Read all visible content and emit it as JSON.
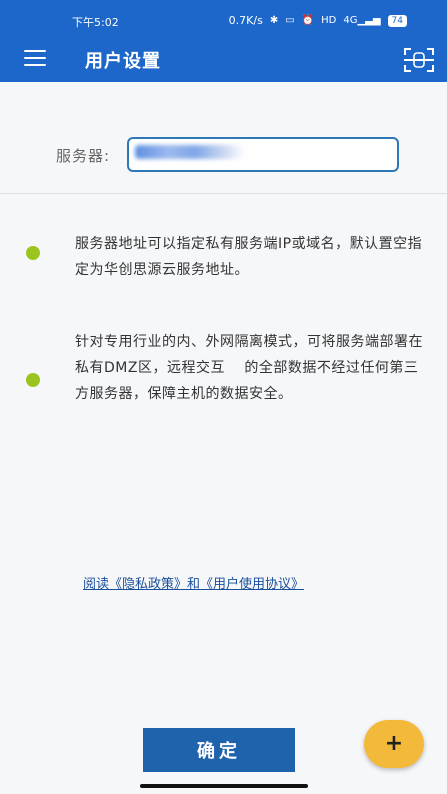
{
  "status_bar": {
    "time": "下午5:02",
    "speed": "0.7K/s",
    "hd": "HD",
    "signal": "4G",
    "battery": "74"
  },
  "toolbar": {
    "title": "用户设置"
  },
  "form": {
    "server_label": "服务器:"
  },
  "info": {
    "paragraph_1": "服务器地址可以指定私有服务端IP或域名，默认置空指定为华创思源云服务地址。",
    "paragraph_2": "针对专用行业的内、外网隔离模式，可将服务端部署在私有DMZ区，远程交互　 的全部数据不经过任何第三方服务器，保障主机的数据安全。"
  },
  "links": {
    "prefix": "阅读",
    "privacy": "《隐私政策》",
    "and": "和",
    "terms": "《用户使用协议》"
  },
  "actions": {
    "confirm": "确定",
    "fab": "+"
  },
  "colors": {
    "app_bar": "#1c67c9",
    "accent_green": "#9ac51f",
    "confirm_button": "#1f63ad",
    "fab": "#f3b93b"
  }
}
